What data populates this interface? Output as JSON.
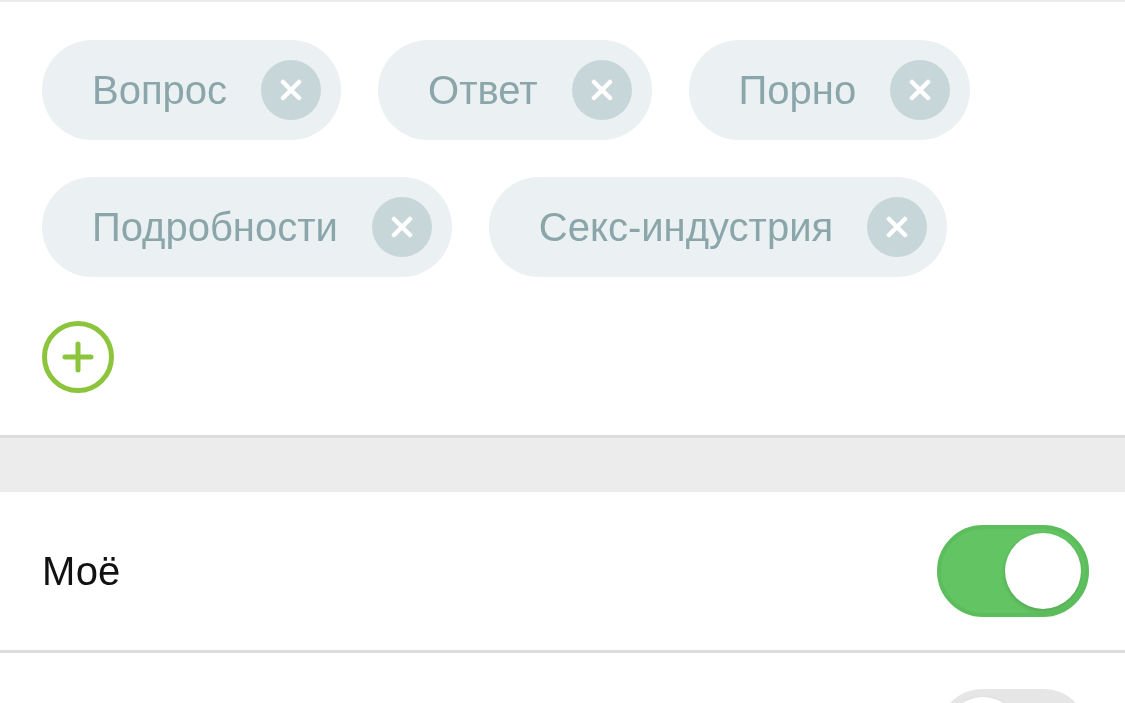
{
  "tags": [
    {
      "label": "Вопрос"
    },
    {
      "label": "Ответ"
    },
    {
      "label": "Порно"
    },
    {
      "label": "Подробности"
    },
    {
      "label": "Секс-индустрия"
    }
  ],
  "settings": [
    {
      "label": "Моё",
      "on": true
    },
    {
      "on": false
    }
  ]
}
